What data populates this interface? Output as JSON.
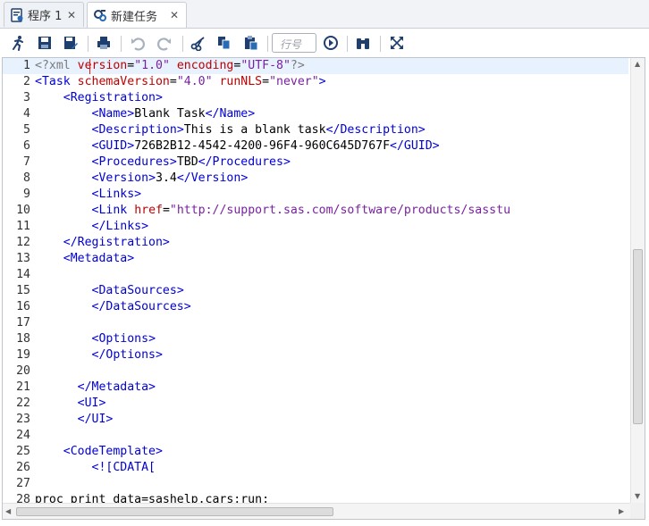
{
  "tabs": [
    {
      "label": "程序 1",
      "icon": "program-icon",
      "active": false
    },
    {
      "label": "新建任务",
      "icon": "task-icon",
      "active": true
    }
  ],
  "toolbar": {
    "icons": [
      "run-icon",
      "save-icon",
      "save-as-icon",
      "print-icon",
      "undo-icon",
      "redo-icon",
      "cut-icon",
      "copy-icon",
      "paste-icon",
      "go-icon",
      "binoculars-icon",
      "maximize-icon"
    ],
    "goto_placeholder": "行号"
  },
  "editor": {
    "lines": [
      {
        "n": "1",
        "c": "<?xml version=\"1.0\" encoding=\"UTF-8\"?>"
      },
      {
        "n": "2",
        "c": "<Task schemaVersion=\"4.0\" runNLS=\"never\">"
      },
      {
        "n": "3",
        "c": "    <Registration>"
      },
      {
        "n": "4",
        "c": "        <Name>Blank Task</Name>"
      },
      {
        "n": "5",
        "c": "        <Description>This is a blank task</Description>"
      },
      {
        "n": "6",
        "c": "        <GUID>726B2B12-4542-4200-96F4-960C645D767F</GUID>"
      },
      {
        "n": "7",
        "c": "        <Procedures>TBD</Procedures>"
      },
      {
        "n": "8",
        "c": "        <Version>3.4</Version>"
      },
      {
        "n": "9",
        "c": "        <Links>"
      },
      {
        "n": "10",
        "c": "        <Link href=\"http://support.sas.com/software/products/sasstu"
      },
      {
        "n": "11",
        "c": "        </Links>"
      },
      {
        "n": "12",
        "c": "    </Registration>"
      },
      {
        "n": "13",
        "c": "    <Metadata>"
      },
      {
        "n": "14",
        "c": ""
      },
      {
        "n": "15",
        "c": "        <DataSources>"
      },
      {
        "n": "16",
        "c": "        </DataSources>"
      },
      {
        "n": "17",
        "c": ""
      },
      {
        "n": "18",
        "c": "        <Options>"
      },
      {
        "n": "19",
        "c": "        </Options>"
      },
      {
        "n": "20",
        "c": ""
      },
      {
        "n": "21",
        "c": "      </Metadata>"
      },
      {
        "n": "22",
        "c": "      <UI>"
      },
      {
        "n": "23",
        "c": "      </UI>"
      },
      {
        "n": "24",
        "c": ""
      },
      {
        "n": "25",
        "c": "    <CodeTemplate>"
      },
      {
        "n": "26",
        "c": "        <![CDATA["
      },
      {
        "n": "27",
        "c": ""
      },
      {
        "n": "28",
        "c": "proc print data=sashelp.cars;run;"
      }
    ]
  }
}
